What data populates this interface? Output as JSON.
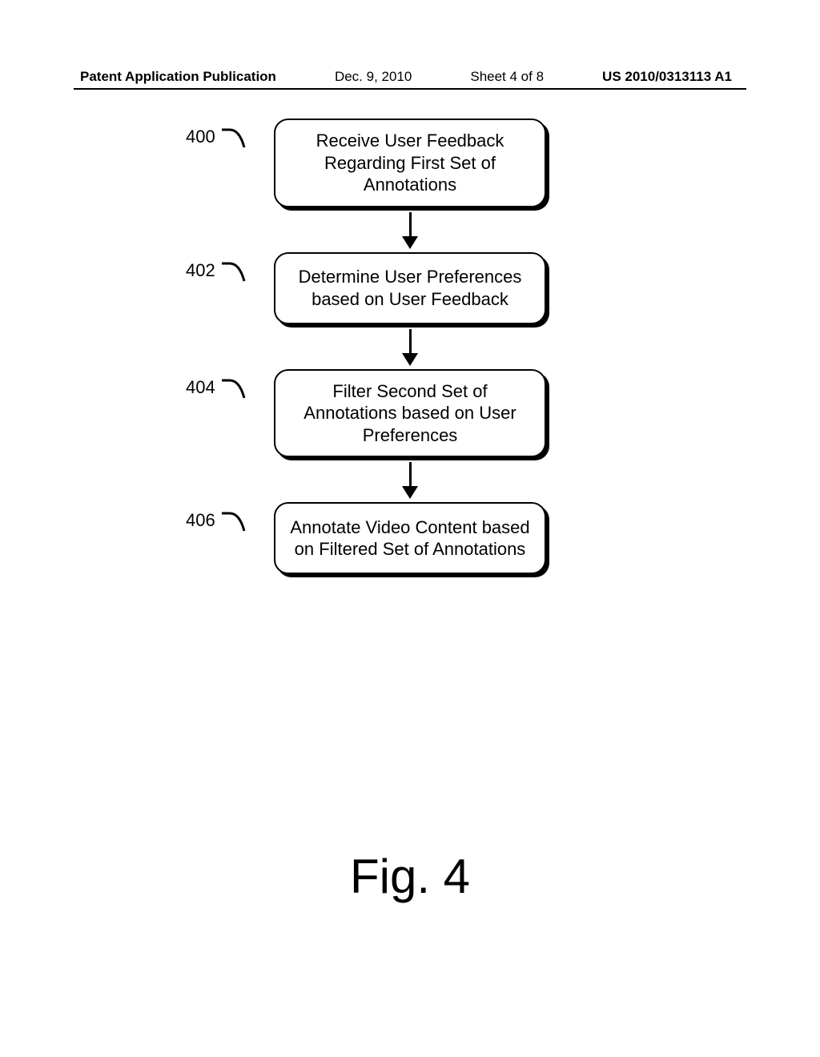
{
  "header": {
    "publication": "Patent Application Publication",
    "date": "Dec. 9, 2010",
    "sheet": "Sheet 4 of 8",
    "docnum": "US 2010/0313113 A1"
  },
  "steps": [
    {
      "ref": "400",
      "text": "Receive User Feedback Regarding First Set of Annotations"
    },
    {
      "ref": "402",
      "text": "Determine User Preferences based on User Feedback"
    },
    {
      "ref": "404",
      "text": "Filter Second Set of Annotations based on User Preferences"
    },
    {
      "ref": "406",
      "text": "Annotate Video Content based on Filtered Set of Annotations"
    }
  ],
  "figure_caption": "Fig. 4"
}
